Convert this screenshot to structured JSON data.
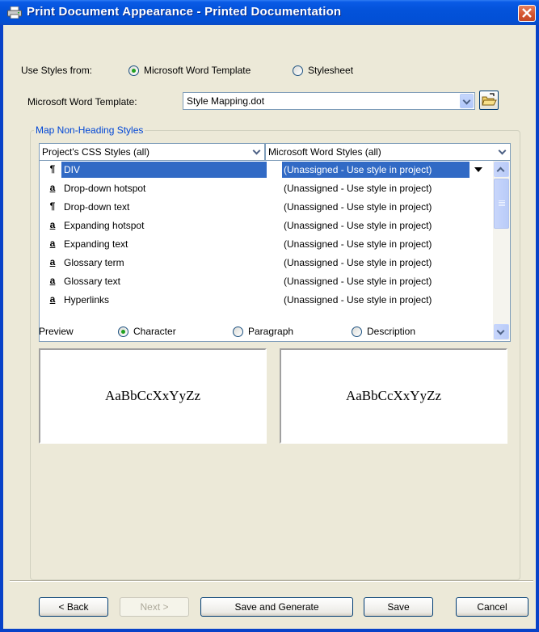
{
  "window": {
    "title": "Print Document Appearance - Printed Documentation"
  },
  "use_styles": {
    "label": "Use Styles from:",
    "options": [
      {
        "label": "Microsoft Word Template",
        "selected": true
      },
      {
        "label": "Stylesheet",
        "selected": false
      }
    ]
  },
  "template": {
    "label": "Microsoft Word Template:",
    "value": "Style Mapping.dot"
  },
  "map_group": {
    "title": "Map Non-Heading Styles",
    "col_project": "Project's CSS Styles (all)",
    "col_word": "Microsoft Word Styles (all)",
    "rows": [
      {
        "icon": "¶",
        "icon_name": "paragraph-style-icon",
        "name": "DIV",
        "word": "(Unassigned - Use style in project)",
        "selected": true
      },
      {
        "icon": "a",
        "icon_name": "character-style-icon",
        "name": "Drop-down hotspot",
        "word": "(Unassigned - Use style in project)"
      },
      {
        "icon": "¶",
        "icon_name": "paragraph-style-icon",
        "name": "Drop-down text",
        "word": "(Unassigned - Use style in project)"
      },
      {
        "icon": "a",
        "icon_name": "character-style-icon",
        "name": "Expanding hotspot",
        "word": "(Unassigned - Use style in project)"
      },
      {
        "icon": "a",
        "icon_name": "character-style-icon",
        "name": "Expanding text",
        "word": "(Unassigned - Use style in project)"
      },
      {
        "icon": "a",
        "icon_name": "character-style-icon",
        "name": "Glossary term",
        "word": "(Unassigned - Use style in project)"
      },
      {
        "icon": "a",
        "icon_name": "character-style-icon",
        "name": "Glossary text",
        "word": "(Unassigned - Use style in project)"
      },
      {
        "icon": "a",
        "icon_name": "character-style-icon",
        "name": "Hyperlinks",
        "word": "(Unassigned - Use style in project)"
      }
    ]
  },
  "preview": {
    "label": "Preview",
    "options": [
      {
        "label": "Character",
        "selected": true
      },
      {
        "label": "Paragraph",
        "selected": false
      },
      {
        "label": "Description",
        "selected": false
      }
    ],
    "left_sample": "AaBbCcXxYyZz",
    "right_sample": "AaBbCcXxYyZz"
  },
  "buttons": {
    "back": "< Back",
    "next": "Next >",
    "save_generate": "Save and Generate",
    "save": "Save",
    "cancel": "Cancel"
  }
}
